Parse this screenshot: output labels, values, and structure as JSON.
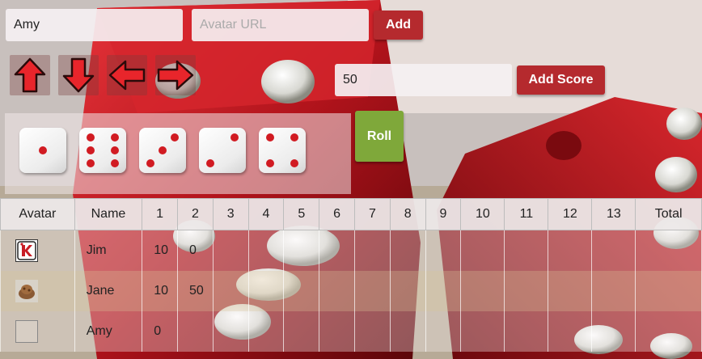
{
  "player_form": {
    "name_value": "Amy",
    "avatar_placeholder": "Avatar URL",
    "add_label": "Add"
  },
  "arrows": [
    "arrow-up-icon",
    "arrow-down-icon",
    "arrow-left-icon",
    "arrow-right-icon"
  ],
  "score_form": {
    "score_value": "50",
    "add_score_label": "Add Score"
  },
  "dice": [
    1,
    6,
    3,
    2,
    4
  ],
  "roll_label": "Roll",
  "table": {
    "headers": [
      "Avatar",
      "Name",
      "1",
      "2",
      "3",
      "4",
      "5",
      "6",
      "7",
      "8",
      "9",
      "10",
      "11",
      "12",
      "13",
      "Total"
    ],
    "rows": [
      {
        "avatar": "king-card-icon",
        "name": "Jim",
        "scores": [
          "10",
          "0",
          "",
          "",
          "",
          "",
          "",
          "",
          "",
          "",
          "",
          "",
          ""
        ],
        "total": ""
      },
      {
        "avatar": "food-photo-icon",
        "name": "Jane",
        "scores": [
          "10",
          "50",
          "",
          "",
          "",
          "",
          "",
          "",
          "",
          "",
          "",
          "",
          ""
        ],
        "total": ""
      },
      {
        "avatar": "empty-avatar",
        "name": "Amy",
        "scores": [
          "0",
          "",
          "",
          "",
          "",
          "",
          "",
          "",
          "",
          "",
          "",
          "",
          ""
        ],
        "total": ""
      }
    ]
  },
  "colors": {
    "primary_red": "#b52a2e",
    "roll_green": "#7fa83a",
    "pip_red": "#d11b22"
  }
}
